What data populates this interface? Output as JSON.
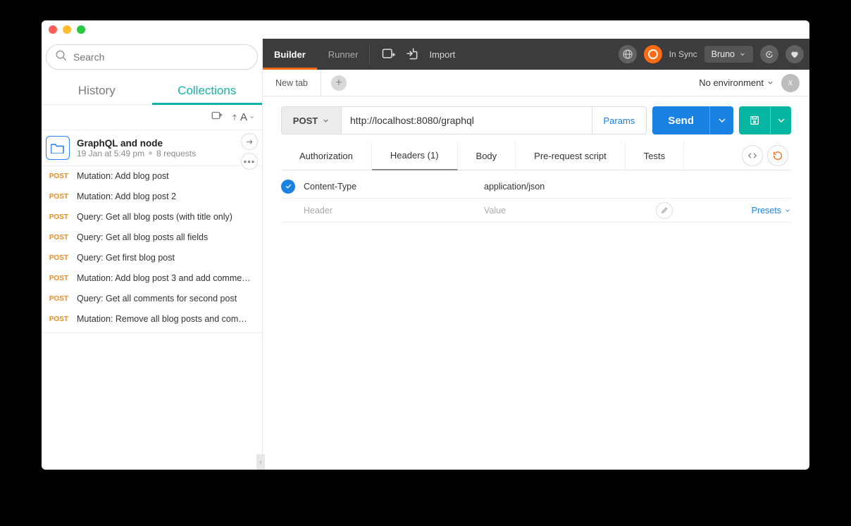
{
  "search": {
    "placeholder": "Search"
  },
  "sidebarTabs": {
    "history": "History",
    "collections": "Collections"
  },
  "collection": {
    "title": "GraphQL and node",
    "date": "19 Jan at 5:49 pm",
    "count": "8 requests"
  },
  "requests": [
    {
      "method": "POST",
      "label": "Mutation: Add blog post"
    },
    {
      "method": "POST",
      "label": "Mutation: Add blog post 2"
    },
    {
      "method": "POST",
      "label": "Query: Get all blog posts (with title only)"
    },
    {
      "method": "POST",
      "label": "Query: Get all blog posts all fields"
    },
    {
      "method": "POST",
      "label": "Query: Get first blog post"
    },
    {
      "method": "POST",
      "label": "Mutation: Add blog post 3 and add comme…"
    },
    {
      "method": "POST",
      "label": "Query: Get all comments for second post"
    },
    {
      "method": "POST",
      "label": "Mutation: Remove all blog posts and com…"
    }
  ],
  "topbar": {
    "builder": "Builder",
    "runner": "Runner",
    "import": "Import",
    "syncStatus": "In Sync",
    "user": "Bruno"
  },
  "tabstrip": {
    "tab0": "New tab",
    "env": "No environment"
  },
  "request": {
    "method": "POST",
    "url": "http://localhost:8080/graphql",
    "params": "Params",
    "send": "Send"
  },
  "subtabs": {
    "auth": "Authorization",
    "headers": "Headers (1)",
    "body": "Body",
    "prereq": "Pre-request script",
    "tests": "Tests"
  },
  "headers": {
    "row0": {
      "key": "Content-Type",
      "value": "application/json"
    },
    "placeholderKey": "Header",
    "placeholderValue": "Value",
    "presets": "Presets"
  }
}
